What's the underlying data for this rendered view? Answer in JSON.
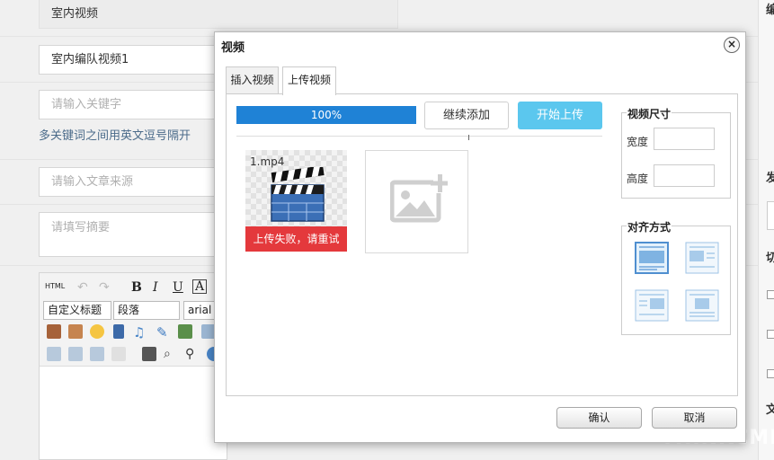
{
  "form": {
    "title_value": "室内视频",
    "subtitle_value": "室内编队视频1",
    "keywords_placeholder": "请输入关键字",
    "keywords_hint": "多关键词之间用英文逗号隔开",
    "source_placeholder": "请输入文章来源",
    "summary_placeholder": "请填写摘要"
  },
  "editor": {
    "html_label": "HTML",
    "bold": "B",
    "italic": "I",
    "underline": "U",
    "font_color": "A",
    "custom_title_select": "自定义标题",
    "paragraph_select": "段落",
    "font_select": "arial"
  },
  "right_col": {
    "mark1": "编",
    "mark2": "发",
    "mark3": "切",
    "mark4": "文"
  },
  "watermark": "THINKCMF",
  "dialog": {
    "title": "视频",
    "close_glyph": "×",
    "tabs": [
      {
        "label": "插入视频"
      },
      {
        "label": "上传视频"
      }
    ],
    "upload": {
      "progress_text": "100%",
      "progress": 1.0,
      "continue_label": "继续添加",
      "start_label": "开始上传",
      "file_name": "1.mp4",
      "file_error": "上传失败，请重试"
    },
    "size_box": {
      "title": "视频尺寸",
      "width_label": "宽度",
      "height_label": "高度",
      "width_value": "",
      "height_value": ""
    },
    "align_box": {
      "title": "对齐方式",
      "options": [
        "none-icon",
        "left-icon",
        "right-icon",
        "center-icon"
      ]
    },
    "ok_label": "确认",
    "cancel_label": "取消"
  },
  "colors": {
    "progress": "#1f82d6",
    "start_button": "#5bc7ee",
    "error": "#e4393c"
  }
}
